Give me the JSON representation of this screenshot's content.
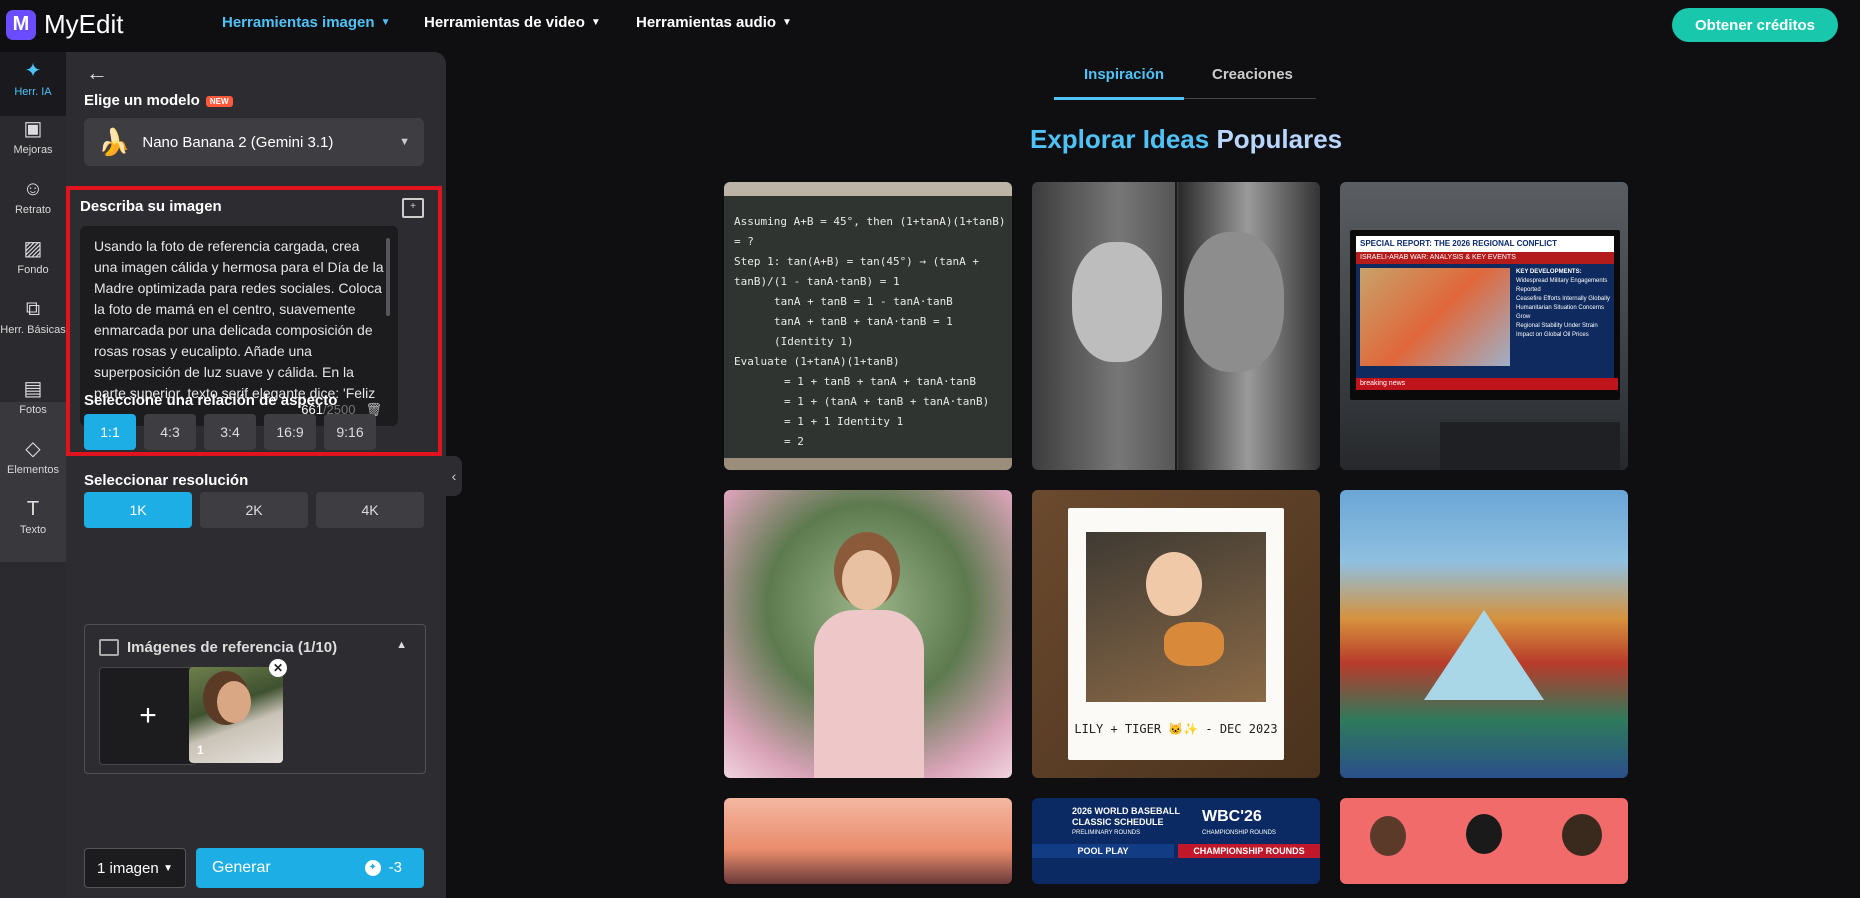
{
  "app": {
    "name": "MyEdit",
    "logo_letter": "M"
  },
  "nav": {
    "items": [
      {
        "label": "Herramientas imagen",
        "active": true
      },
      {
        "label": "Herramientas de video",
        "active": false
      },
      {
        "label": "Herramientas audio",
        "active": false
      }
    ],
    "credits_button": "Obtener créditos"
  },
  "rail": {
    "items": [
      {
        "label": "Herr. IA",
        "icon": "magic-wand-icon",
        "active": true
      },
      {
        "label": "Mejoras",
        "icon": "image-enhance-icon"
      },
      {
        "label": "Retrato",
        "icon": "portrait-icon"
      },
      {
        "label": "Fondo",
        "icon": "background-icon"
      },
      {
        "label": "Herr. Básicas",
        "icon": "crop-icon"
      },
      {
        "label": "Fotos",
        "icon": "photos-icon"
      },
      {
        "label": "Elementos",
        "icon": "shapes-icon"
      },
      {
        "label": "Texto",
        "icon": "text-icon"
      }
    ]
  },
  "panel": {
    "model_label": "Elige un modelo",
    "model_badge": "NEW",
    "model_name": "Nano Banana 2 (Gemini 3.1)",
    "describe_label": "Describa su imagen",
    "prompt_text": "Usando la foto de referencia cargada, crea una imagen cálida y hermosa para el Día de la Madre optimizada para redes sociales. Coloca la foto de mamá en el centro, suavemente enmarcada por una delicada composición de rosas rosas y eucalipto. Añade una superposición de luz suave y cálida. En la parte superior, texto serif elegante dice: 'Feliz Día de",
    "char_count": "661",
    "char_max": "/2500",
    "aspect_label": "Seleccione una relación de aspecto",
    "aspect_options": [
      "1:1",
      "4:3",
      "3:4",
      "16:9",
      "9:16"
    ],
    "aspect_selected": "1:1",
    "resolution_label": "Seleccionar resolución",
    "resolution_options": [
      "1K",
      "2K",
      "4K"
    ],
    "resolution_selected": "1K",
    "ref_label": "Imágenes de referencia (1/10)",
    "ref_add": "+",
    "ref_thumb_number": "1",
    "image_count": "1 imagen",
    "generate_label": "Generar",
    "generate_cost": "-3"
  },
  "gallery": {
    "tabs": [
      {
        "label": "Inspiración",
        "active": true
      },
      {
        "label": "Creaciones",
        "active": false
      }
    ],
    "heading_part1": "Explorar Ideas",
    "heading_part2": "Populares",
    "cards": [
      {
        "type": "chalkboard",
        "lines": [
          "Assuming A+B = 45°, then (1+tanA)(1+tanB) = ?",
          "Step 1: tan(A+B) = tan(45°) → (tanA + tanB)/(1 - tanA·tanB) = 1",
          "tanA + tanB = 1 - tanA·tanB",
          "tanA + tanB + tanA·tanB = 1 (Identity 1)",
          "Evaluate (1+tanA)(1+tanB)",
          "= 1 + tanB + tanA + tanA·tanB",
          "= 1 + (tanA + tanB + tanA·tanB)",
          "= 1 + 1   Identity 1",
          "= 2"
        ]
      },
      {
        "type": "photo-bw"
      },
      {
        "type": "tv",
        "headline": "SPECIAL REPORT: THE 2026 REGIONAL CONFLICT",
        "subhead": "ISRAELI-ARAB WAR: ANALYSIS & KEY EVENTS",
        "key_title": "KEY DEVELOPMENTS:",
        "bullets": [
          "Widespread Military Engagements Reported",
          "Ceasefire Efforts Internally Globally",
          "Humanitarian Situation Concerns Grow",
          "Regional Stability Under Strain",
          "Impact on Global Oil Prices"
        ],
        "ticker": "breaking news"
      },
      {
        "type": "photo-garden"
      },
      {
        "type": "polaroid",
        "caption": "LILY + TIGER 🐱✨ - DEC 2023"
      },
      {
        "type": "louvre"
      },
      {
        "type": "sunset"
      },
      {
        "type": "wbc",
        "title": "2026 WORLD BASEBALL CLASSIC SCHEDULE",
        "subtitle": "PRELIMINARY ROUNDS",
        "logo": "WBC'26",
        "logo_sub": "CHAMPIONSHIP ROUNDS",
        "pool": "POOL PLAY",
        "champ": "CHAMPIONSHIP ROUNDS"
      },
      {
        "type": "illustration"
      }
    ]
  },
  "colors": {
    "accent": "#4fc3f7",
    "credits": "#19c7ad",
    "primary_button": "#1eaee6",
    "highlight_border": "#e0141e"
  }
}
